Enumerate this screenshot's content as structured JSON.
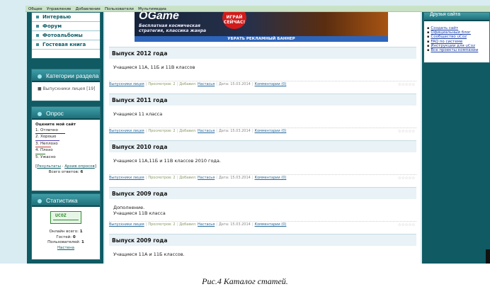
{
  "topbar": [
    "Общее",
    "Управление",
    "Добавление",
    "Пользователи",
    "Мультимедиа"
  ],
  "left_menu": [
    "Интервью",
    "Форум",
    "Фотоальбомы",
    "Гостевая книга"
  ],
  "categories": {
    "title": "Категории раздела",
    "item": "Выпускники лицея [19]"
  },
  "poll": {
    "title": "Опрос",
    "question": "Оцените мой сайт",
    "options": [
      "1. Отлично",
      "2. Хорошо",
      "3. Неплохо",
      "4. Плохо",
      "5. Ужасно"
    ],
    "results_link": "Результаты",
    "archive_link": "Архив опросов",
    "total_label": "Всего ответов:",
    "total_value": "6"
  },
  "stats": {
    "title": "Статистика",
    "badge": "UCOZ",
    "online": "Онлайн всего:",
    "online_v": "1",
    "guests": "Гостей:",
    "guests_v": "0",
    "users": "Пользователей:",
    "users_v": "1",
    "user_link": "Настена"
  },
  "banner": {
    "logo": "OGame",
    "tagline_1": "Бесплатная космическая",
    "tagline_2": "стратегия, классика жанра",
    "burst": "ИГРАЙ СЕЙЧАС!",
    "remove": "УБРАТЬ РЕКЛАМНЫЙ БАННЕР"
  },
  "entries": [
    {
      "title": "Выпуск 2012 года",
      "text": "Учащиеся 11А, 11Б и 11В классов"
    },
    {
      "title": "Выпуск 2011 года",
      "text": "Учащиеся 11 класса"
    },
    {
      "title": "Выпуск 2010 года",
      "text": "Учащиеся 11А,11Б и 11В классов 2010 года."
    },
    {
      "title": "Выпуск 2009 года",
      "text": "Дополнение.",
      "text2": "Учащиеся 11В класса"
    },
    {
      "title": "Выпуск 2009 года",
      "text": "Учащиеся 11А и 11Б  классов."
    }
  ],
  "meta": {
    "category": "Выпускники лицея",
    "views_label": "Просмотров:",
    "views_value": "2",
    "added_label": "Добавил:",
    "author": "Настасья",
    "date_label": "Дата:",
    "date": "15.03.2014",
    "comments": "Комментарии (0)"
  },
  "friends": {
    "title": "Друзья сайта",
    "links": [
      "Создать сайт",
      "Официальный блог",
      "Сообщество uCoz",
      "FAQ по системе",
      "Инструкции для uCoz",
      "Все проекты компании"
    ]
  },
  "caption": "Рис.4  Каталог статей."
}
